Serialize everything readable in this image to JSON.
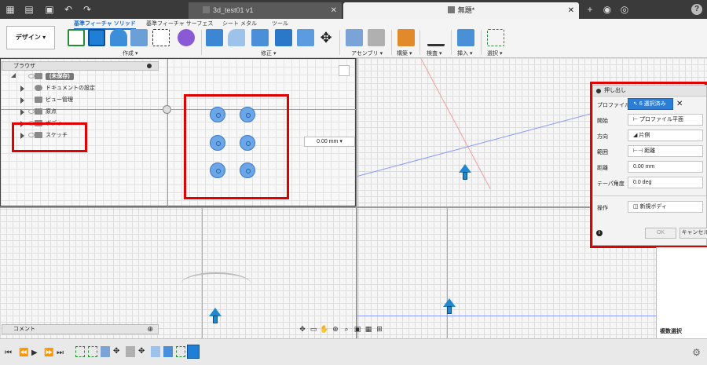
{
  "tabs": {
    "inactive_title": "3d_test01 v1",
    "active_title": "無題*"
  },
  "ribbon": {
    "design_label": "デザイン ▾",
    "tabs": [
      "基準フィーチャ ソリッド",
      "基準フィーチャ サーフェス",
      "シート メタル",
      "ツール"
    ],
    "groups": [
      "作成 ▾",
      "修正 ▾",
      "アセンブリ ▾",
      "構築 ▾",
      "検査 ▾",
      "挿入 ▾",
      "選択 ▾"
    ]
  },
  "browser": {
    "title": "ブラウザ",
    "root": "(未保存)",
    "items": [
      "ドキュメントの設定",
      "ビュー管理",
      "原点",
      "ボディ",
      "スケッチ"
    ]
  },
  "dimension_value": "0.00 mm",
  "extrude": {
    "title": "押し出し",
    "rows": [
      {
        "label": "プロファイル",
        "value": "6 選択済み"
      },
      {
        "label": "開始",
        "value": "プロファイル平面"
      },
      {
        "label": "方向",
        "value": "片側"
      },
      {
        "label": "範囲",
        "value": "距離"
      },
      {
        "label": "距離",
        "value": "0.00 mm"
      },
      {
        "label": "テーパ角度",
        "value": "0.0 deg"
      },
      {
        "label": "操作",
        "value": "新規ボディ"
      }
    ],
    "ok_label": "OK",
    "cancel_label": "キャンセル"
  },
  "comment_label": "コメント",
  "multi_select_label": "複数選択",
  "colors": {
    "accent": "#1a6fcc",
    "highlight": "#e00000",
    "sketch_fill": "#6aa6e8"
  }
}
